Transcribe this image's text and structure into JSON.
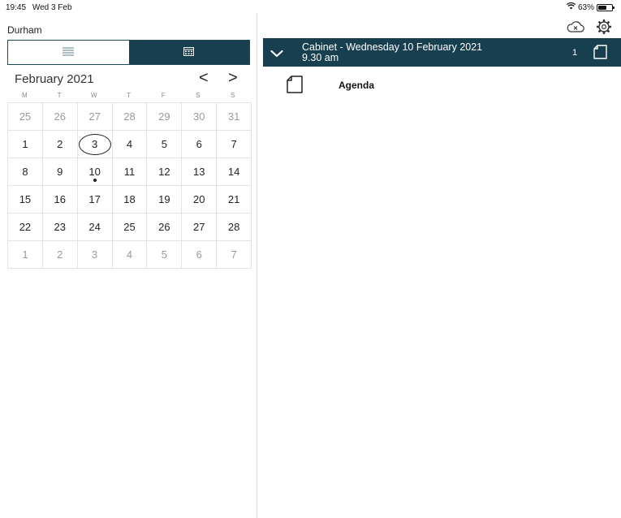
{
  "status_bar": {
    "time": "19:45",
    "date": "Wed 3 Feb",
    "battery": "63%",
    "battery_level": 0.63,
    "icons": [
      "wifi-icon",
      "battery-icon"
    ]
  },
  "sidebar": {
    "organization": "Durham",
    "view_toggle": {
      "options": [
        "list-view-icon",
        "calendar-view-icon"
      ],
      "selected": "calendar-view-icon"
    },
    "calendar": {
      "month_label": "February 2021",
      "prev_label": "<",
      "next_label": ">",
      "weekdays": [
        "M",
        "T",
        "W",
        "T",
        "F",
        "S",
        "S"
      ],
      "weeks": [
        [
          {
            "d": "25",
            "muted": true
          },
          {
            "d": "26",
            "muted": true
          },
          {
            "d": "27",
            "muted": true
          },
          {
            "d": "28",
            "muted": true
          },
          {
            "d": "29",
            "muted": true
          },
          {
            "d": "30",
            "muted": true
          },
          {
            "d": "31",
            "muted": true
          }
        ],
        [
          {
            "d": "1"
          },
          {
            "d": "2"
          },
          {
            "d": "3",
            "today": true
          },
          {
            "d": "4"
          },
          {
            "d": "5"
          },
          {
            "d": "6"
          },
          {
            "d": "7"
          }
        ],
        [
          {
            "d": "8"
          },
          {
            "d": "9"
          },
          {
            "d": "10",
            "event": true
          },
          {
            "d": "11"
          },
          {
            "d": "12"
          },
          {
            "d": "13"
          },
          {
            "d": "14"
          }
        ],
        [
          {
            "d": "15"
          },
          {
            "d": "16"
          },
          {
            "d": "17"
          },
          {
            "d": "18"
          },
          {
            "d": "19"
          },
          {
            "d": "20"
          },
          {
            "d": "21"
          }
        ],
        [
          {
            "d": "22"
          },
          {
            "d": "23"
          },
          {
            "d": "24"
          },
          {
            "d": "25"
          },
          {
            "d": "26"
          },
          {
            "d": "27"
          },
          {
            "d": "28"
          }
        ],
        [
          {
            "d": "1",
            "muted": true
          },
          {
            "d": "2",
            "muted": true
          },
          {
            "d": "3",
            "muted": true
          },
          {
            "d": "4",
            "muted": true
          },
          {
            "d": "5",
            "muted": true
          },
          {
            "d": "6",
            "muted": true
          },
          {
            "d": "7",
            "muted": true
          }
        ]
      ]
    }
  },
  "toolbar": {
    "icons": [
      "cloud-offline-icon",
      "gear-icon"
    ]
  },
  "meeting": {
    "title_line1": "Cabinet - Wednesday 10 February 2021",
    "title_line2": "9.30 am",
    "document_count": "1",
    "documents": [
      {
        "label": "Agenda",
        "icon": "document-icon"
      }
    ]
  },
  "colors": {
    "header_bg": "#173f4f",
    "header_text": "#ffffff",
    "divider": "#d8d8d8"
  }
}
